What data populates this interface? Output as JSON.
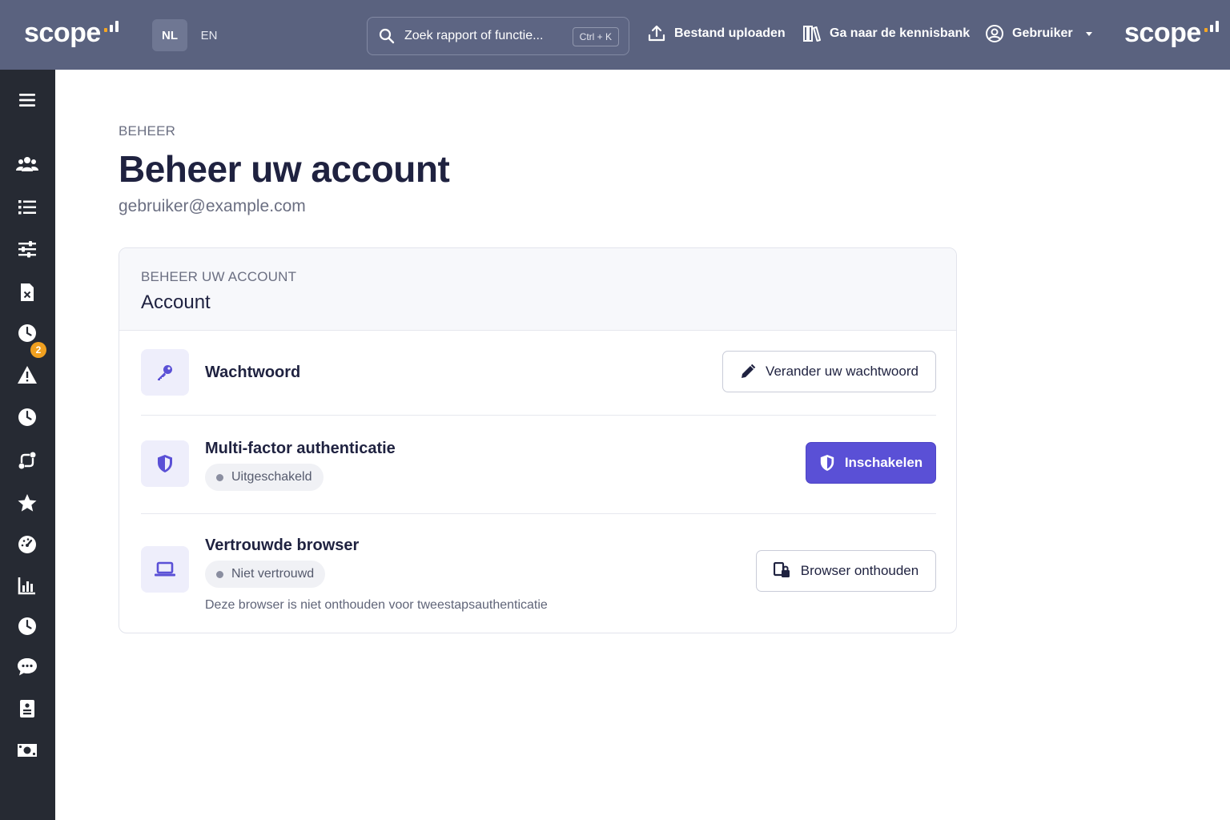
{
  "brand": {
    "logo_text": "scope"
  },
  "colors": {
    "topbar": "#5a627f",
    "sidebar": "#262a33",
    "primary": "#5a50d6",
    "badge": "#f0a020"
  },
  "header": {
    "languages": [
      {
        "label": "NL",
        "active": true
      },
      {
        "label": "EN",
        "active": false
      }
    ],
    "search": {
      "placeholder": "Zoek rapport of functie...",
      "shortcut": "Ctrl + K"
    },
    "upload_label": "Bestand uploaden",
    "knowledge_label": "Ga naar de kennisbank",
    "user_label": "Gebruiker"
  },
  "sidebar": {
    "items": [
      {
        "icon": "menu-icon"
      },
      {
        "icon": "users-icon"
      },
      {
        "icon": "list-icon"
      },
      {
        "icon": "sliders-icon"
      },
      {
        "icon": "file-x-icon",
        "badge": "2"
      },
      {
        "icon": "clock-icon"
      },
      {
        "icon": "warning-icon"
      },
      {
        "icon": "clock-icon"
      },
      {
        "icon": "route-icon"
      },
      {
        "icon": "star-icon"
      },
      {
        "icon": "gauge-icon"
      },
      {
        "icon": "bar-chart-icon"
      },
      {
        "icon": "clock-icon"
      },
      {
        "icon": "chat-icon"
      },
      {
        "icon": "id-card-icon"
      },
      {
        "icon": "money-icon"
      }
    ]
  },
  "page": {
    "eyebrow": "BEHEER",
    "title": "Beheer uw account",
    "email": "gebruiker@example.com"
  },
  "card": {
    "eyebrow": "BEHEER UW ACCOUNT",
    "title": "Account",
    "rows": {
      "password": {
        "icon": "key-icon",
        "title": "Wachtwoord",
        "button": "Verander uw wachtwoord"
      },
      "mfa": {
        "icon": "shield-icon",
        "title": "Multi-factor authenticatie",
        "status": "Uitgeschakeld",
        "button": "Inschakelen"
      },
      "browser": {
        "icon": "laptop-icon",
        "title": "Vertrouwde browser",
        "status": "Niet vertrouwd",
        "description": "Deze browser is niet onthouden voor tweestapsauthenticatie",
        "button": "Browser onthouden"
      }
    }
  }
}
